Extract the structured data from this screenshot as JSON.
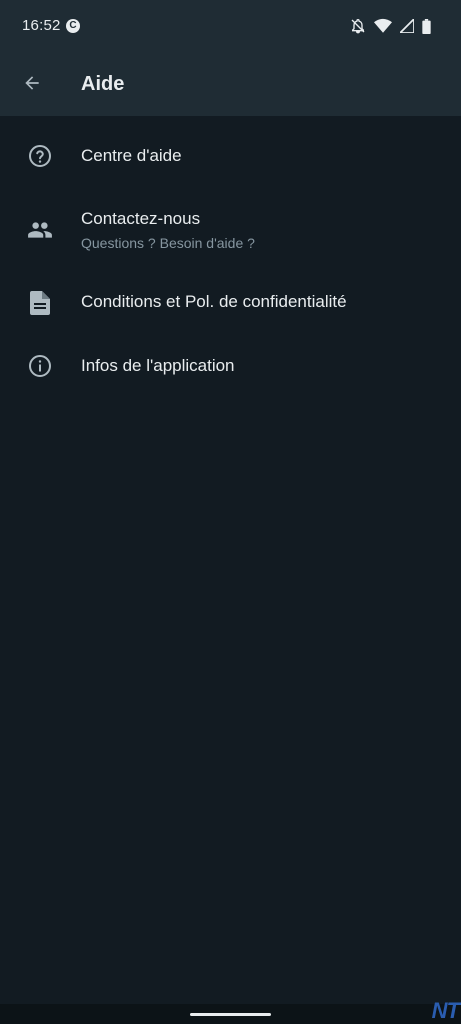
{
  "status_bar": {
    "time": "16:52",
    "app_icon_letter": "C"
  },
  "app_bar": {
    "title": "Aide"
  },
  "menu": {
    "items": [
      {
        "label": "Centre d'aide",
        "icon": "help-circle-icon"
      },
      {
        "label": "Contactez-nous",
        "sublabel": "Questions ? Besoin d'aide ?",
        "icon": "people-icon"
      },
      {
        "label": "Conditions et Pol. de confidentialité",
        "icon": "document-icon"
      },
      {
        "label": "Infos de l'application",
        "icon": "info-icon"
      }
    ]
  },
  "watermark": "NT",
  "colors": {
    "background": "#121b22",
    "toolbar": "#1f2c34",
    "primary_text": "#e9edef",
    "secondary_text": "#8696a0",
    "icon": "#aebac1"
  }
}
